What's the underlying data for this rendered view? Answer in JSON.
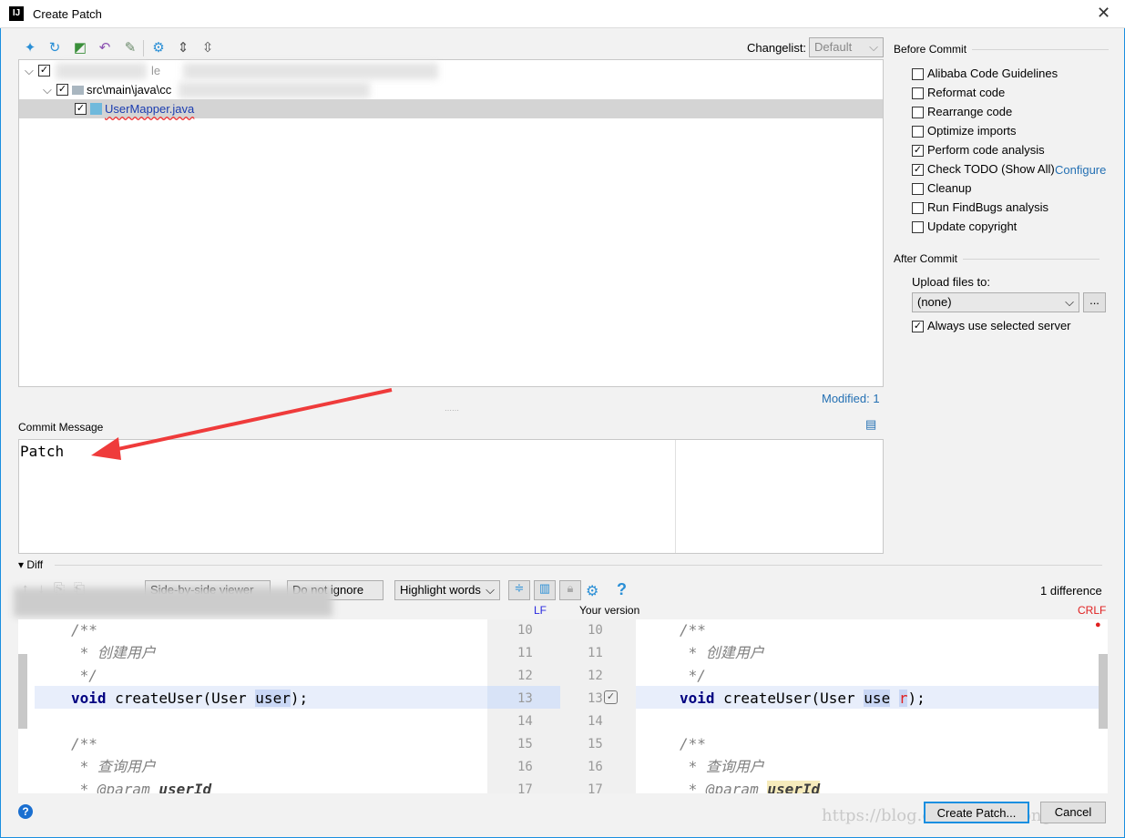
{
  "window": {
    "title": "Create Patch",
    "close": "✕"
  },
  "toolbar": {
    "icons": [
      "collapse-all-icon",
      "refresh-icon",
      "diff-icon",
      "rollback-icon",
      "edit-icon",
      "settings-icon",
      "expand-icon",
      "collapse-icon"
    ]
  },
  "changelist": {
    "label": "Changelist:",
    "value": "Default"
  },
  "tree": {
    "root_suffix": "le",
    "folder": "src\\main\\java\\cc",
    "file": "UserMapper.java"
  },
  "modified": "Modified: 1",
  "commit": {
    "label": "Commit Message",
    "value": "Patch"
  },
  "before_commit": {
    "title": "Before Commit",
    "items": [
      {
        "label": "Alibaba Code Guidelines",
        "checked": false
      },
      {
        "label": "Reformat code",
        "checked": false
      },
      {
        "label": "Rearrange code",
        "checked": false
      },
      {
        "label": "Optimize imports",
        "checked": false
      },
      {
        "label": "Perform code analysis",
        "checked": true
      },
      {
        "label": "Check TODO (Show All)",
        "checked": true,
        "link": "Configure"
      },
      {
        "label": "Cleanup",
        "checked": false
      },
      {
        "label": "Run FindBugs analysis",
        "checked": false
      },
      {
        "label": "Update copyright",
        "checked": false
      }
    ]
  },
  "after_commit": {
    "title": "After Commit",
    "upload_label": "Upload files to:",
    "upload_value": "(none)",
    "browse": "...",
    "always_label": "Always use selected server",
    "always_checked": true
  },
  "diff": {
    "title": "Diff",
    "viewer": "Side-by-side viewer",
    "ignore": "Do not ignore",
    "highlight": "Highlight words",
    "difference_count": "1 difference",
    "left_sep": "LF",
    "right_title": "Your version",
    "right_sep": "CRLF",
    "left_lines": [
      "/**",
      " * 创建用户",
      " */",
      "void createUser(User user);",
      "",
      "/**",
      " * 查询用户",
      " * @param userId"
    ],
    "right_lines": [
      "/**",
      " * 创建用户",
      " */",
      "void createUser(User use r);",
      "",
      "/**",
      " * 查询用户",
      " * @param userId"
    ],
    "line_numbers": [
      "10",
      "11",
      "12",
      "13",
      "14",
      "15",
      "16",
      "17"
    ]
  },
  "buttons": {
    "create": "Create Patch...",
    "cancel": "Cancel",
    "help": "?"
  },
  "watermark": "https://blog.csdn.net/LitongZero",
  "colors": {
    "accent": "#1a8fe0",
    "link": "#2470b3",
    "changed_line": "#e8eefb",
    "arrow": "#ef3b3b"
  }
}
